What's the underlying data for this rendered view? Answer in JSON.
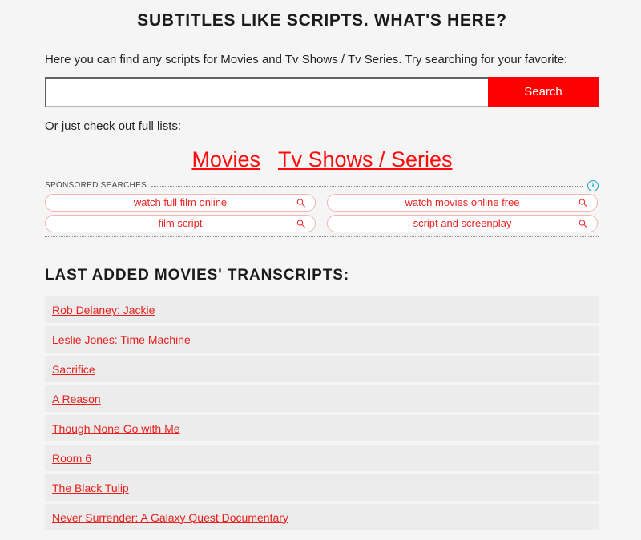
{
  "header": {
    "title": "SUBTITLES LIKE SCRIPTS. WHAT'S HERE?"
  },
  "intro": {
    "text": "Here you can find any scripts for Movies and Tv Shows / Tv Series. Try searching for your favorite:"
  },
  "search": {
    "value": "",
    "placeholder": "",
    "button_label": "Search"
  },
  "full_lists": {
    "note": "Or just check out full lists:",
    "links": [
      {
        "label": "Movies"
      },
      {
        "label": "Tv Shows / Series"
      }
    ]
  },
  "sponsored": {
    "label": "SPONSORED SEARCHES",
    "info_glyph": "i",
    "items": [
      {
        "text": "watch full film online"
      },
      {
        "text": "watch movies online free"
      },
      {
        "text": "film script"
      },
      {
        "text": "script and screenplay"
      }
    ]
  },
  "last_added": {
    "title": "LAST ADDED MOVIES' TRANSCRIPTS:",
    "items": [
      {
        "title": "Rob Delaney: Jackie"
      },
      {
        "title": "Leslie Jones: Time Machine"
      },
      {
        "title": "Sacrifice"
      },
      {
        "title": "A Reason"
      },
      {
        "title": "Though None Go with Me"
      },
      {
        "title": "Room 6"
      },
      {
        "title": "The Black Tulip"
      },
      {
        "title": "Never Surrender: A Galaxy Quest Documentary"
      }
    ]
  },
  "colors": {
    "page_background": "#f5f5f5",
    "row_background": "#ececec",
    "accent_red": "#ff0000",
    "link_red": "#e8201d",
    "ad_border_pink": "#f3b4b4",
    "info_cyan": "#1aa7c4"
  }
}
